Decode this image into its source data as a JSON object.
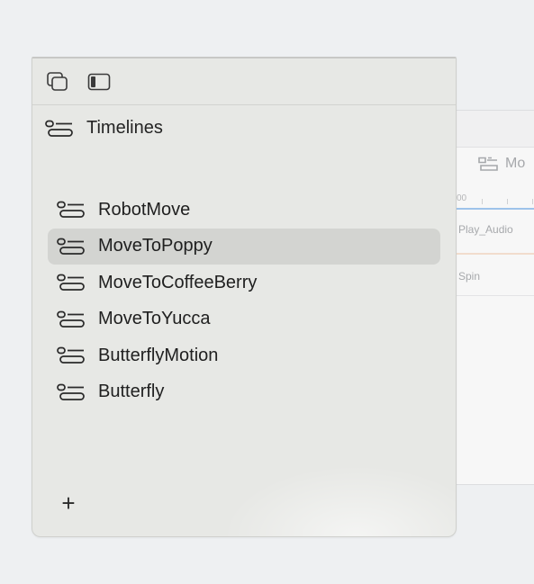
{
  "editor": {
    "tab_label": "Mo",
    "ruler_label": "00",
    "tracks": [
      {
        "label": "Play_Audio"
      },
      {
        "label": "Spin"
      }
    ]
  },
  "panel": {
    "toolbar": {
      "windows_icon": "overlapping-windows-icon",
      "sidebar_icon": "sidebar-toggle-icon"
    },
    "section_title": "Timelines",
    "timelines": [
      {
        "label": "RobotMove",
        "selected": false
      },
      {
        "label": "MoveToPoppy",
        "selected": true
      },
      {
        "label": "MoveToCoffeeBerry",
        "selected": false
      },
      {
        "label": "MoveToYucca",
        "selected": false
      },
      {
        "label": "ButterflyMotion",
        "selected": false
      },
      {
        "label": "Butterfly",
        "selected": false
      }
    ],
    "add_label": "+"
  },
  "colors": {
    "panel_bg": "#e7e8e5",
    "selection_bg": "#d3d4d1",
    "text": "#202020",
    "ruler_accent": "#9ec3ea",
    "audio_track_accent": "#f1dccd"
  }
}
